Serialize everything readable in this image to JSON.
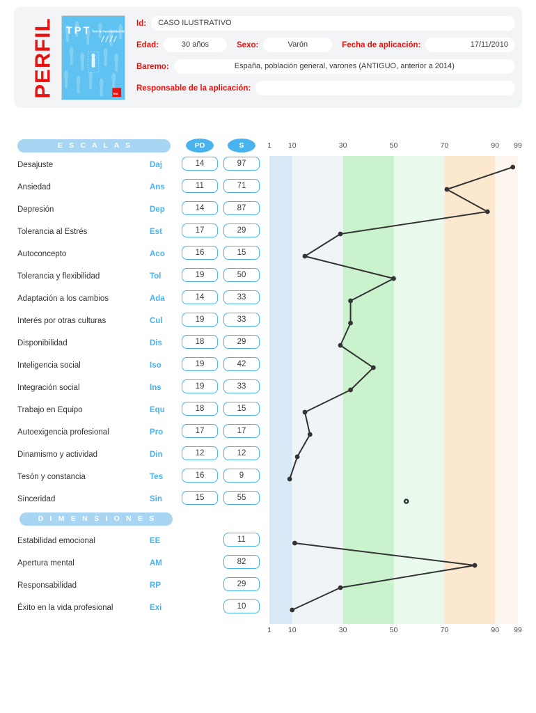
{
  "header": {
    "title": "PERFIL",
    "cover_logo": "TPT",
    "cover_subtitle": "Test de Personalidad de TEA",
    "cover_publisher": "TEA",
    "fields": [
      {
        "label": "Id:",
        "value": "CASO ILUSTRATIVO",
        "name": "id"
      },
      {
        "label": "Edad:",
        "value": "30 años",
        "name": "edad"
      },
      {
        "label": "Sexo:",
        "value": "Varón",
        "name": "sexo"
      },
      {
        "label": "Fecha de aplicación:",
        "value": "17/11/2010",
        "name": "fecha"
      },
      {
        "label": "Baremo:",
        "value": "España, población general, varones (ANTIGUO, anterior a 2014)",
        "name": "baremo"
      },
      {
        "label": "Responsable de la aplicación:",
        "value": "",
        "name": "responsable"
      }
    ]
  },
  "table": {
    "section_escalas": "E S C A L A S",
    "section_dimensiones": "D I M E N S I O N E S",
    "col_pd": "PD",
    "col_s": "S",
    "escalas": [
      {
        "label": "Desajuste",
        "abbr": "Daj",
        "pd": "14",
        "s": "97"
      },
      {
        "label": "Ansiedad",
        "abbr": "Ans",
        "pd": "11",
        "s": "71"
      },
      {
        "label": "Depresión",
        "abbr": "Dep",
        "pd": "14",
        "s": "87"
      },
      {
        "label": "Tolerancia al Estrés",
        "abbr": "Est",
        "pd": "17",
        "s": "29"
      },
      {
        "label": "Autoconcepto",
        "abbr": "Aco",
        "pd": "16",
        "s": "15"
      },
      {
        "label": "Tolerancia y flexibilidad",
        "abbr": "Tol",
        "pd": "19",
        "s": "50"
      },
      {
        "label": "Adaptación a los cambios",
        "abbr": "Ada",
        "pd": "14",
        "s": "33"
      },
      {
        "label": "Interés por otras culturas",
        "abbr": "Cul",
        "pd": "19",
        "s": "33"
      },
      {
        "label": "Disponibilidad",
        "abbr": "Dis",
        "pd": "18",
        "s": "29"
      },
      {
        "label": "Inteligencia social",
        "abbr": "Iso",
        "pd": "19",
        "s": "42"
      },
      {
        "label": "Integración social",
        "abbr": "Ins",
        "pd": "19",
        "s": "33"
      },
      {
        "label": "Trabajo en Equipo",
        "abbr": "Equ",
        "pd": "18",
        "s": "15"
      },
      {
        "label": "Autoexigencia profesional",
        "abbr": "Pro",
        "pd": "17",
        "s": "17"
      },
      {
        "label": "Dinamismo y actividad",
        "abbr": "Din",
        "pd": "12",
        "s": "12"
      },
      {
        "label": "Tesón y constancia",
        "abbr": "Tes",
        "pd": "16",
        "s": "9"
      },
      {
        "label": "Sinceridad",
        "abbr": "Sin",
        "pd": "15",
        "s": "55"
      }
    ],
    "dimensiones": [
      {
        "label": "Estabilidad emocional",
        "abbr": "EE",
        "pd": "",
        "s": "11"
      },
      {
        "label": "Apertura mental",
        "abbr": "AM",
        "pd": "",
        "s": "82"
      },
      {
        "label": "Responsabilidad",
        "abbr": "RP",
        "pd": "",
        "s": "29"
      },
      {
        "label": "Éxito en la vida profesional",
        "abbr": "Exi",
        "pd": "",
        "s": "10"
      }
    ]
  },
  "chart_data": {
    "type": "line",
    "title": "",
    "xlabel": "",
    "ylabel": "",
    "orientation": "horizontal",
    "xlim": [
      1,
      99
    ],
    "grid": false,
    "legend": null,
    "tick_labels": [
      "1",
      "10",
      "30",
      "50",
      "70",
      "90",
      "99"
    ],
    "tick_values": [
      1,
      10,
      30,
      50,
      70,
      90,
      99
    ],
    "bands": [
      {
        "from": 1,
        "to": 10,
        "color": "#d8e9f8"
      },
      {
        "from": 10,
        "to": 30,
        "color": "#eff4f7"
      },
      {
        "from": 30,
        "to": 50,
        "color": "#c9f2cd"
      },
      {
        "from": 50,
        "to": 70,
        "color": "#e9faec"
      },
      {
        "from": 70,
        "to": 90,
        "color": "#fbe8cf"
      },
      {
        "from": 90,
        "to": 99,
        "color": "#fdf7f0"
      }
    ],
    "line_color": "#333333",
    "series": [
      {
        "name": "Escalas",
        "categories": [
          "Daj",
          "Ans",
          "Dep",
          "Est",
          "Aco",
          "Tol",
          "Ada",
          "Cul",
          "Dis",
          "Iso",
          "Ins",
          "Equ",
          "Pro",
          "Din",
          "Tes"
        ],
        "values": [
          97,
          71,
          87,
          29,
          15,
          50,
          33,
          33,
          29,
          42,
          33,
          15,
          17,
          12,
          9
        ],
        "marker": "filled-circle",
        "connected": true
      },
      {
        "name": "Sinceridad",
        "categories": [
          "Sin"
        ],
        "values": [
          55
        ],
        "marker": "open-circle",
        "connected": false
      },
      {
        "name": "Dimensiones",
        "categories": [
          "EE",
          "AM",
          "RP",
          "Exi"
        ],
        "values": [
          11,
          82,
          29,
          10
        ],
        "marker": "filled-circle",
        "connected": true
      }
    ]
  }
}
